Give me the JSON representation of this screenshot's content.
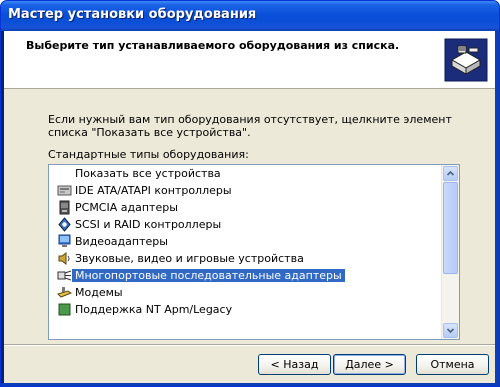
{
  "window": {
    "title": "Мастер установки оборудования"
  },
  "header": {
    "heading": "Выберите тип устанавливаемого оборудования из списка.",
    "icon": "hardware-wizard-icon"
  },
  "intro_text": "Если нужный вам тип оборудования отсутствует, щелкните элемент списка \"Показать все устройства\".",
  "list_label": "Стандартные типы оборудования:",
  "list": {
    "items": [
      {
        "label": "Показать все устройства",
        "icon": "none"
      },
      {
        "label": "IDE ATA/ATAPI контроллеры",
        "icon": "ide-controller-icon"
      },
      {
        "label": "PCMCIA адаптеры",
        "icon": "pcmcia-icon"
      },
      {
        "label": "SCSI и RAID контроллеры",
        "icon": "scsi-icon"
      },
      {
        "label": "Видеоадаптеры",
        "icon": "display-adapter-icon"
      },
      {
        "label": "Звуковые, видео и игровые устройства",
        "icon": "sound-icon"
      },
      {
        "label": "Многопортовые последовательные адаптеры",
        "icon": "multiport-serial-icon",
        "selected": true
      },
      {
        "label": "Модемы",
        "icon": "modem-icon"
      },
      {
        "label": "Поддержка NT Apm/Legacy",
        "icon": "nt-apm-icon"
      }
    ]
  },
  "buttons": {
    "back": "< Назад",
    "next": "Далее >",
    "cancel": "Отмена"
  },
  "colors": {
    "title_bar": "#0a4fd8",
    "dialog_bg": "#ece9d8",
    "selection": "#316ac5",
    "list_border": "#7f9db9"
  }
}
